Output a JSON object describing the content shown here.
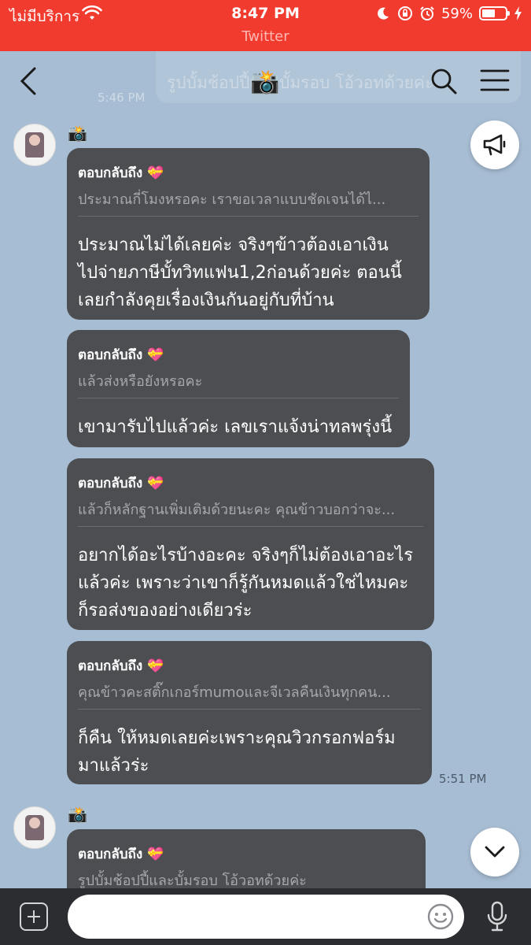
{
  "status_bar": {
    "carrier": "ไม่มีบริการ",
    "time": "8:47 PM",
    "battery": "59%",
    "subtitle": "Twitter"
  },
  "header": {
    "title": "📸",
    "ghost_text": "รูปบั้มช้อปปี้และบั้มรอบ โอ้วอทด้วยค่ะ",
    "ghost_time": "5:46 PM"
  },
  "sender": {
    "name": "📸"
  },
  "bubbles": [
    {
      "reply_title": "ตอบกลับถึง 💝",
      "reply_text": "ประมาณกี่โมงหรอคะ เราขอเวลาแบบชัดเจนได้ไ...",
      "lines": [
        "ประมาณไม่ได้เลยค่ะ จริงๆข้าวต้องเอาเงิน",
        "ไปจ่ายภาษีบั้ทวิทแฟน1,2ก่อนด้วยค่ะ ตอนนี้",
        "เลยกำลังคุยเรื่องเงินกันอยู่กับที่บ้าน"
      ]
    },
    {
      "reply_title": "ตอบกลับถึง 💝",
      "reply_text": "แล้วส่งหรือยังหรอคะ",
      "lines": [
        "เขามารับไปแล้วค่ะ เลขเราแจ้งน่าทลพรุ่งนี้"
      ]
    },
    {
      "reply_title": "ตอบกลับถึง 💝",
      "reply_text": "แล้วก็หลักฐานเพิ่มเติมด้วยนะคะ คุณข้าวบอกว่าจะ...",
      "lines": [
        "อยากได้อะไรบ้างอะคะ จริงๆก็ไม่ต้องเอาอะไร",
        "แล้วค่ะ เพราะว่าเขาก็รู้กันหมดแล้วใช่ไหมคะ",
        "ก็รอส่งของอย่างเดียวร่ะ"
      ]
    },
    {
      "reply_title": "ตอบกลับถึง 💝",
      "reply_text": "คุณข้าวคะสติ๊กเกอร์mumoและจีเวลคืนเงินทุกคน...",
      "lines": [
        "ก็คืน ให้หมดเลยค่ะเพราะคุณวิวกรอกฟอร์ม",
        "มาแล้วร่ะ"
      ],
      "time": "5:51 PM"
    },
    {
      "reply_title": "ตอบกลับถึง 💝",
      "reply_text": "รูปบั้มช้อปปี้และบั้มรอบ โอ้วอทด้วยค่ะ",
      "lines": []
    }
  ],
  "input": {
    "placeholder": ""
  },
  "colors": {
    "status_bar": "#f23b2f",
    "background": "#a7bdd3",
    "bubble": "#4c4e52",
    "input_bar": "#2b2d31"
  }
}
